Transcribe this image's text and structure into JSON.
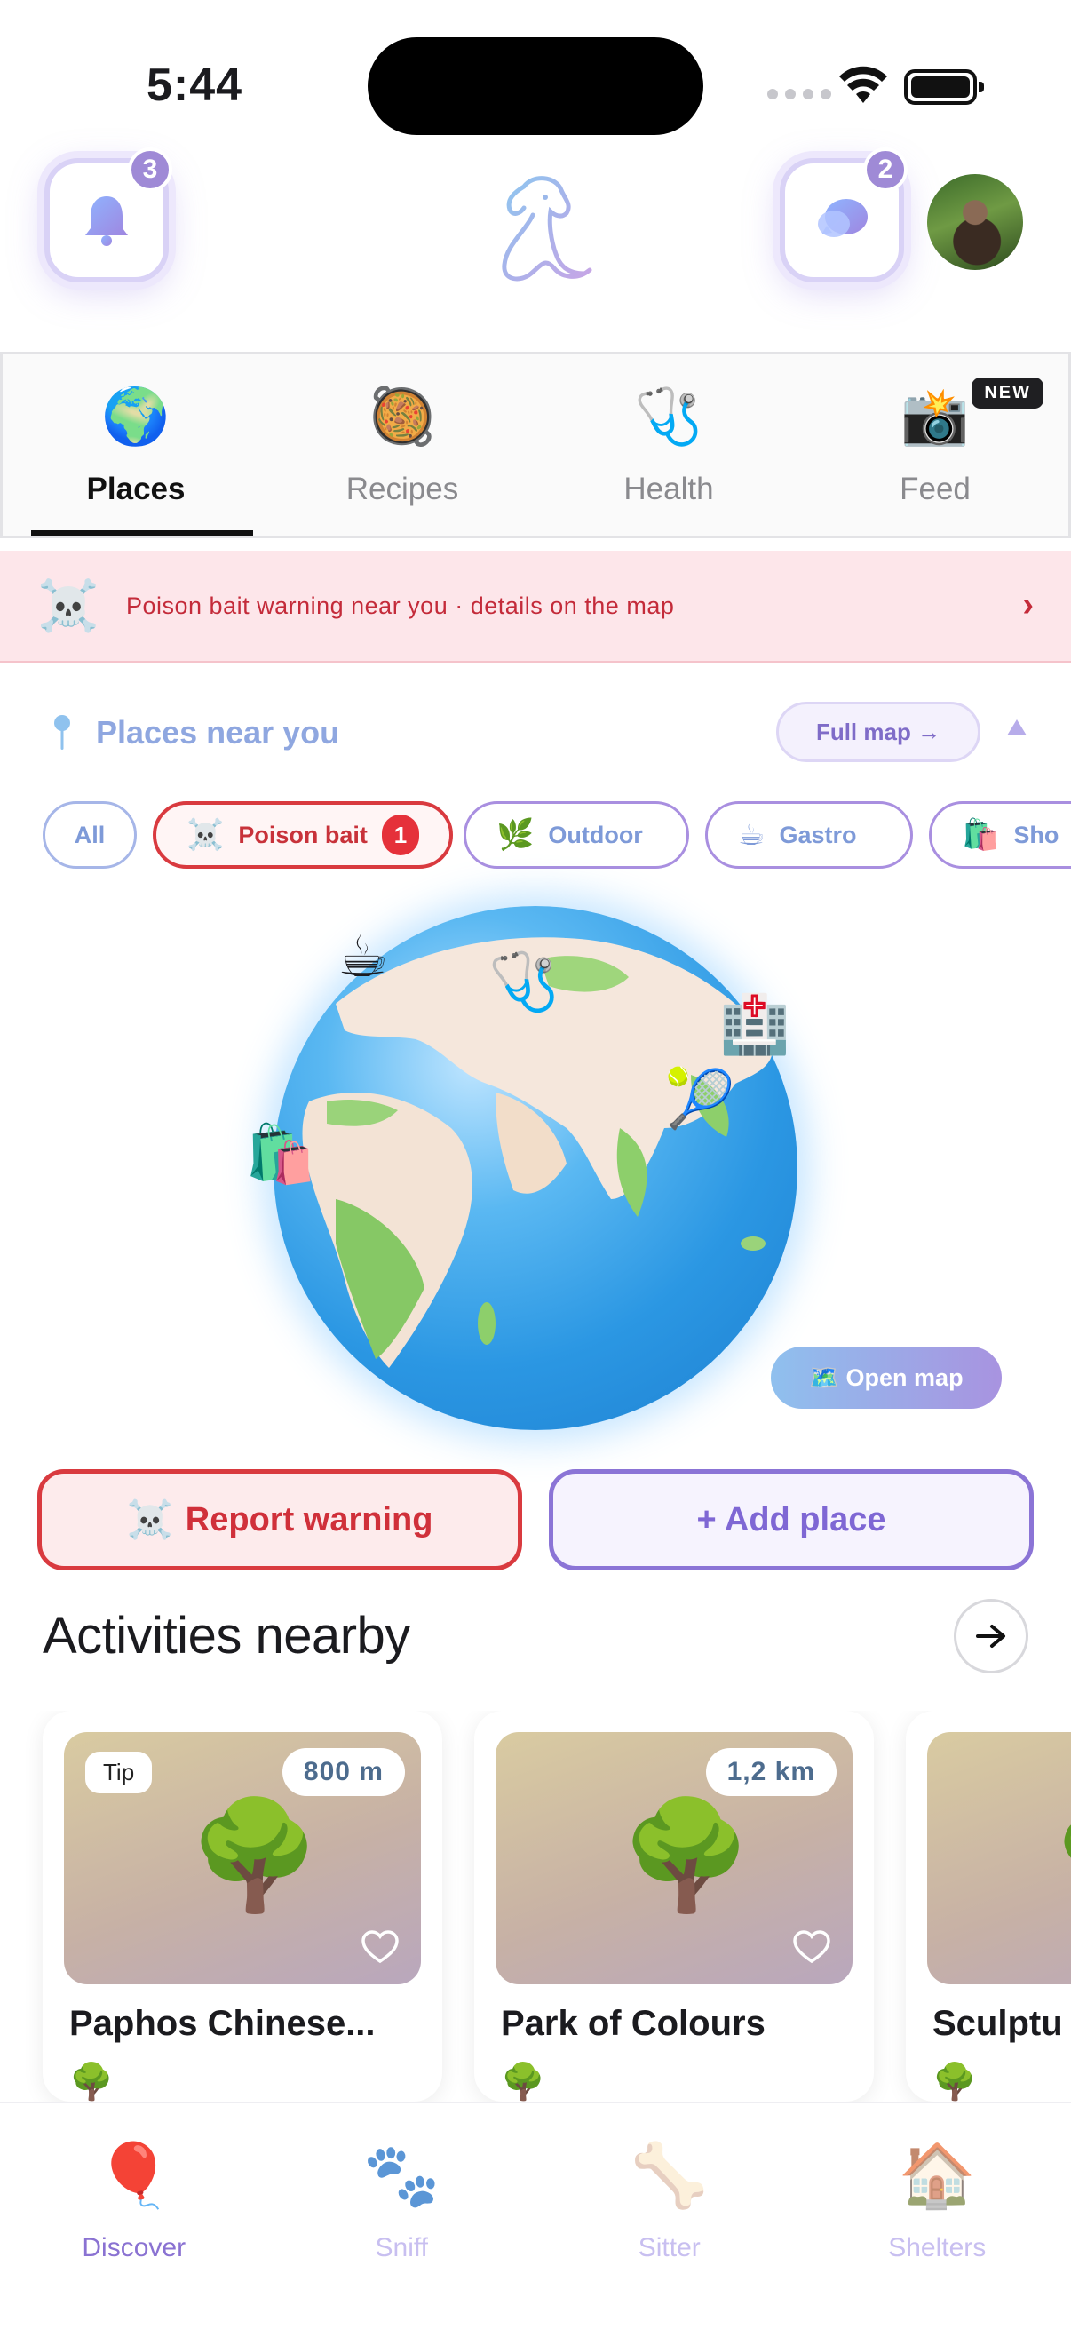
{
  "status_bar": {
    "time": "5:44"
  },
  "header": {
    "notifications_count": "3",
    "messages_count": "2"
  },
  "tabs": [
    {
      "label": "Places",
      "icon": "🌍",
      "active": true
    },
    {
      "label": "Recipes",
      "icon": "🥘",
      "active": false
    },
    {
      "label": "Health",
      "icon": "🩺",
      "active": false
    },
    {
      "label": "Feed",
      "icon": "📸",
      "active": false,
      "badge": "NEW"
    }
  ],
  "warning_banner": {
    "icon": "☠️",
    "text": "Poison bait warning near you · details on the map",
    "chevron": "›"
  },
  "places": {
    "title": "Places near you",
    "full_map_label": "Full map →"
  },
  "filters": [
    {
      "label": "All",
      "icon": ""
    },
    {
      "label": "Poison bait",
      "icon": "☠️",
      "count": "1"
    },
    {
      "label": "Outdoor",
      "icon": "🌿"
    },
    {
      "label": "Gastro",
      "icon": "☕"
    },
    {
      "label": "Sho",
      "icon": "🛍️"
    }
  ],
  "globe": {
    "markers": [
      "☕",
      "🩺",
      "🏥",
      "🎾",
      "🛍️"
    ],
    "open_map_label": "🗺️ Open map"
  },
  "actions": {
    "report_icon": "☠️",
    "report_label": "Report warning",
    "add_place_label": "+ Add place"
  },
  "activities": {
    "title": "Activities nearby",
    "cards": [
      {
        "tip": "Tip",
        "distance": "800 m",
        "title": "Paphos Chinese...",
        "icon": "🌳"
      },
      {
        "tip": "",
        "distance": "1,2 km",
        "title": "Park of Colours",
        "icon": "🌳"
      },
      {
        "tip": "",
        "distance": "",
        "title": "Sculptu",
        "icon": "🌳"
      }
    ]
  },
  "bottom_nav": [
    {
      "label": "Discover",
      "icon": "🎈",
      "active": true
    },
    {
      "label": "Sniff",
      "icon": "🐾",
      "active": false
    },
    {
      "label": "Sitter",
      "icon": "🦴",
      "active": false
    },
    {
      "label": "Shelters",
      "icon": "🏠",
      "active": false
    }
  ]
}
